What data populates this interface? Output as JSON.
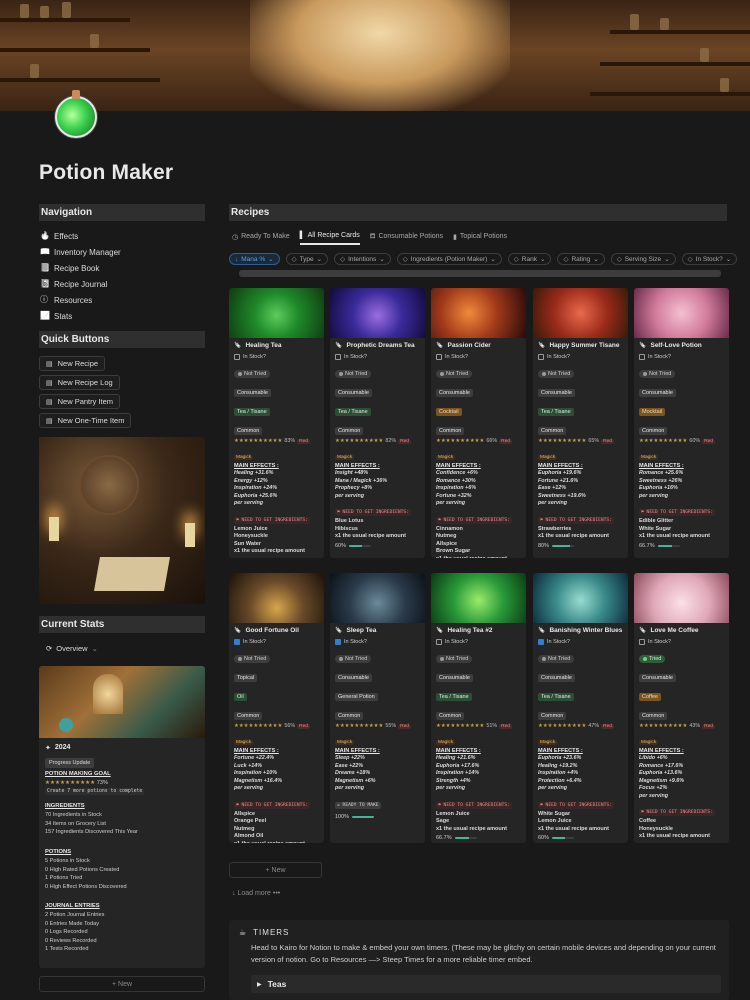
{
  "page": {
    "title": "Potion Maker"
  },
  "navigation": {
    "heading": "Navigation",
    "items": [
      {
        "label": "Effects",
        "icon": "flame-icon"
      },
      {
        "label": "Inventory Manager",
        "icon": "book-open-icon"
      },
      {
        "label": "Recipe Book",
        "icon": "book-icon"
      },
      {
        "label": "Recipe Journal",
        "icon": "notebook-icon"
      },
      {
        "label": "Resources",
        "icon": "info-icon"
      },
      {
        "label": "Stats",
        "icon": "chart-icon"
      }
    ]
  },
  "quick_buttons": {
    "heading": "Quick Buttons",
    "items": [
      "New Recipe",
      "New Recipe Log",
      "New Pantry Item",
      "New One-Time Item"
    ]
  },
  "current_stats": {
    "heading": "Current Stats",
    "view_label": "Overview",
    "year": "2024",
    "badge": "Progress Update",
    "goal_heading": "POTION MAKING GOAL",
    "goal_percent": "73%",
    "goal_fraction": 0.73,
    "goal_note": "Create 7 more potions to complete",
    "ingredients_heading": "INGREDIENTS",
    "ingredients": [
      "70 Ingredients in Stock",
      "34 Items on Grocery List",
      "157 Ingredients Discovered This Year"
    ],
    "potions_heading": "POTIONS",
    "potions": [
      "5 Potions in Stock",
      "0 High Rated Potions Created",
      "1 Potions Tried",
      "0 High Effect Potions Discovered"
    ],
    "journal_heading": "JOURNAL ENTRIES",
    "journal": [
      "2 Potion Journal Entries",
      "0 Entries Made Today",
      "0 Logs Recorded",
      "0 Reviews Recorded",
      "1 Tests Recorded"
    ],
    "new_label": "New"
  },
  "recipes": {
    "heading": "Recipes",
    "tabs": [
      "Ready To Make",
      "All Recipe Cards",
      "Consumable Potions",
      "Topical Potions"
    ],
    "active_tab": 1,
    "filters": [
      "Mana %",
      "Type",
      "Intentions",
      "Ingredients (Potion Maker)",
      "Rank",
      "Rating",
      "Serving Size",
      "In Stock?"
    ],
    "new_label": "New",
    "load_more": "Load more",
    "labels": {
      "in_stock": "In Stock?",
      "main_effects": "MAIN EFFECTS :",
      "need_ingredients": "NEED TO GET INGREDIENTS:",
      "ready_to_make": "READY TO MAKE",
      "magick": "Magick",
      "red": "Red",
      "stars": "★★★★★★★★★★"
    },
    "cards": [
      {
        "title": "Healing Tea",
        "in_stock": false,
        "status": "Not Tried",
        "type": "Consumable",
        "category": "Tea / Tisane",
        "rank": "Common",
        "mana": "83%",
        "mana_fraction": 0.83,
        "effects": [
          "Healing +31.6%",
          "Energy +12%",
          "Inspiration +24%",
          "Euphoria +25.6%",
          "per serving"
        ],
        "need": true,
        "ingredients": [
          "Lemon Juice",
          "Honeysuckle",
          "Sun Water",
          "x1 the usual recipe amount"
        ],
        "progress": "40%",
        "progress_fraction": 0.4
      },
      {
        "title": "Prophetic Dreams Tea",
        "in_stock": false,
        "status": "Not Tried",
        "type": "Consumable",
        "category": "Tea / Tisane",
        "rank": "Common",
        "mana": "82%",
        "mana_fraction": 0.82,
        "effects": [
          "Insight +48%",
          "Mana / Magick +36%",
          "Prophecy +8%",
          "per serving"
        ],
        "need": true,
        "ingredients": [
          "Blue Lotus",
          "Hibiscus",
          "x1 the usual recipe amount"
        ],
        "progress": "60%",
        "progress_fraction": 0.6
      },
      {
        "title": "Passion Cider",
        "in_stock": false,
        "status": "Not Tried",
        "type": "Consumable",
        "category": "Cocktail",
        "rank": "Common",
        "mana": "66%",
        "mana_fraction": 0.66,
        "effects": [
          "Confidence +6%",
          "Romance +30%",
          "Inspiration +6%",
          "Fortune +32%",
          "per serving"
        ],
        "need": true,
        "ingredients": [
          "Cinnamon",
          "Nutmeg",
          "Allspice",
          "Brown Sugar",
          "x1 the usual recipe amount"
        ],
        "progress": "42.9%",
        "progress_fraction": 0.429
      },
      {
        "title": "Happy Summer Tisane",
        "in_stock": false,
        "status": "Not Tried",
        "type": "Consumable",
        "category": "Tea / Tisane",
        "rank": "Common",
        "mana": "65%",
        "mana_fraction": 0.65,
        "effects": [
          "Euphoria +19.6%",
          "Fortune +21.6%",
          "Ease +12%",
          "Sweetness +19.6%",
          "per serving"
        ],
        "need": true,
        "ingredients": [
          "Strawberries",
          "x1 the usual recipe amount"
        ],
        "progress": "80%",
        "progress_fraction": 0.8
      },
      {
        "title": "Self-Love Potion",
        "in_stock": false,
        "status": "Not Tried",
        "type": "Consumable",
        "category": "Mocktail",
        "rank": "Common",
        "mana": "60%",
        "mana_fraction": 0.6,
        "effects": [
          "Romance +25.6%",
          "Sweetness +26%",
          "Euphoria +16%",
          "per serving"
        ],
        "need": true,
        "ingredients": [
          "Edible Glitter",
          "White Sugar",
          "x1 the usual recipe amount"
        ],
        "progress": "66.7%",
        "progress_fraction": 0.667
      },
      {
        "title": "Good Fortune Oil",
        "in_stock": true,
        "status": "Not Tried",
        "type": "Topical",
        "category": "Oil",
        "rank": "Common",
        "mana": "56%",
        "mana_fraction": 0.56,
        "effects": [
          "Fortune +22.4%",
          "Luck +14%",
          "Inspiration +10%",
          "Magnetism +16.4%",
          "per serving"
        ],
        "need": true,
        "ingredients": [
          "Allspice",
          "Orange Peel",
          "Nutmeg",
          "Almond Oil",
          "x1 the usual recipe amount"
        ],
        "progress": "20%",
        "progress_fraction": 0.2
      },
      {
        "title": "Sleep Tea",
        "in_stock": true,
        "status": "Not Tried",
        "type": "Consumable",
        "category": "General Potion",
        "rank": "Common",
        "mana": "55%",
        "mana_fraction": 0.55,
        "effects": [
          "Sleep +22%",
          "Ease +22%",
          "Dreams +18%",
          "Magnetism +6%",
          "per serving"
        ],
        "need": false,
        "ingredients": [],
        "progress": "100%",
        "progress_fraction": 1.0
      },
      {
        "title": "Healing Tea #2",
        "in_stock": false,
        "status": "Not Tried",
        "type": "Consumable",
        "category": "Tea / Tisane",
        "rank": "Common",
        "mana": "51%",
        "mana_fraction": 0.51,
        "effects": [
          "Healing +21.6%",
          "Euphoria +17.6%",
          "Inspiration +14%",
          "Strength +4%",
          "per serving"
        ],
        "need": true,
        "ingredients": [
          "Lemon Juice",
          "Sage",
          "x1 the usual recipe amount"
        ],
        "progress": "66.7%",
        "progress_fraction": 0.667
      },
      {
        "title": "Banishing Winter Blues",
        "in_stock": true,
        "status": "Not Tried",
        "type": "Consumable",
        "category": "Tea / Tisane",
        "rank": "Common",
        "mana": "47%",
        "mana_fraction": 0.47,
        "effects": [
          "Euphoria +23.6%",
          "Healing +19.2%",
          "Inspiration +4%",
          "Protection +6.4%",
          "per serving"
        ],
        "need": true,
        "ingredients": [
          "White Sugar",
          "Lemon Juice",
          "x1 the usual recipe amount"
        ],
        "progress": "60%",
        "progress_fraction": 0.6
      },
      {
        "title": "Love Me Coffee",
        "in_stock": false,
        "status": "Tried",
        "type": "Consumable",
        "category": "Coffee",
        "rank": "Common",
        "mana": "43%",
        "mana_fraction": 0.43,
        "effects": [
          "Libido +6%",
          "Romance +17.6%",
          "Euphoria +13.6%",
          "Magnetism +9.6%",
          "Focus +2%",
          "per serving"
        ],
        "need": true,
        "ingredients": [
          "Coffee",
          "Honeysuckle",
          "x1 the usual recipe amount"
        ],
        "progress": "50%",
        "progress_fraction": 0.5
      }
    ]
  },
  "timers": {
    "heading": "TIMERS",
    "body": "Head to Kairo for Notion to make & embed your own timers. (These may be glitchy on certain mobile devices and depending on your current version of notion. Go to Resources —> Steep Times for a more reliable timer embed.",
    "toggle": "Teas"
  },
  "colors": {
    "background": "#191919",
    "card": "#252525",
    "accent_blue": "#2f7fd0",
    "progress": "#3fb89a",
    "gold": "#c9a24a"
  }
}
